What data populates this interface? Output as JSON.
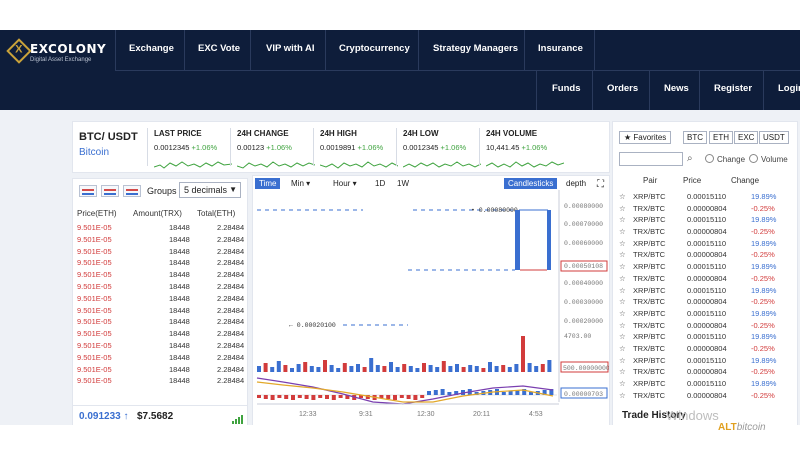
{
  "brand": {
    "name": "EXCOLONY",
    "tagline": "Digital Asset Exchange",
    "mark": "X"
  },
  "nav": {
    "items": [
      "Exchange",
      "EXC Vote",
      "VIP with AI",
      "Cryptocurrency",
      "Strategy Managers",
      "Insurance"
    ],
    "sub_items": [
      "Funds",
      "Orders",
      "News",
      "Register",
      "Login"
    ]
  },
  "ticker": {
    "pair": "BTC/ USDT",
    "coin_name": "Bitcoin",
    "stats": [
      {
        "label": "LAST PRICE",
        "value": "0.0012345",
        "change": "+1.06%"
      },
      {
        "label": "24H CHANGE",
        "value": "0.00123",
        "change": "+1.06%"
      },
      {
        "label": "24H HIGH",
        "value": "0.0019891",
        "change": "+1.06%"
      },
      {
        "label": "24H LOW",
        "value": "0.0012345",
        "change": "+1.06%"
      },
      {
        "label": "24H VOLUME",
        "value": "10,441.45",
        "change": "+1.06%"
      }
    ]
  },
  "orderbook": {
    "groups_label": "Groups",
    "groups_value": "5 decimals",
    "headers": [
      "Price(ETH)",
      "Amount(TRX)",
      "Total(ETH)"
    ],
    "rows": [
      [
        "9.501E-05",
        "18448",
        "2.28484"
      ],
      [
        "9.501E-05",
        "18448",
        "2.28484"
      ],
      [
        "9.501E-05",
        "18448",
        "2.28484"
      ],
      [
        "9.501E-05",
        "18448",
        "2.28484"
      ],
      [
        "9.501E-05",
        "18448",
        "2.28484"
      ],
      [
        "9.501E-05",
        "18448",
        "2.28484"
      ],
      [
        "9.501E-05",
        "18448",
        "2.28484"
      ],
      [
        "9.501E-05",
        "18448",
        "2.28484"
      ],
      [
        "9.501E-05",
        "18448",
        "2.28484"
      ],
      [
        "9.501E-05",
        "18448",
        "2.28484"
      ],
      [
        "9.501E-05",
        "18448",
        "2.28484"
      ],
      [
        "9.501E-05",
        "18448",
        "2.28484"
      ],
      [
        "9.501E-05",
        "18448",
        "2.28484"
      ],
      [
        "9.501E-05",
        "18448",
        "2.28484"
      ]
    ],
    "last_price": "0.091233 ↑",
    "last_usd": "$7.5682"
  },
  "chart_toolbar": {
    "time": "Time",
    "min": "Min",
    "hour": "Hour",
    "d1": "1D",
    "w1": "1W",
    "candlesticks": "Candlesticks",
    "depth": "depth"
  },
  "chart_data": {
    "type": "candlestick",
    "price_ticks": [
      "0.00080000",
      "0.00070000",
      "0.00060000",
      "0.00050108",
      "0.00040000",
      "0.00030000",
      "0.00020000"
    ],
    "volume_tick": "4703.00",
    "volume_max_label": "500.00000000",
    "indicator_label": "0.00000703",
    "annotations": [
      "0.00080000",
      "0.00020100"
    ],
    "time_labels": [
      "12:33",
      "9:31",
      "12:30",
      "20:11",
      "4:53"
    ]
  },
  "favorites": {
    "button": "★ Favorites",
    "quotes": [
      "BTC",
      "ETH",
      "EXC",
      "USDT"
    ],
    "radio_change": "Change",
    "radio_volume": "Volume",
    "headers": [
      "Pair",
      "Price",
      "Change"
    ],
    "rows": [
      [
        "XRP/BTC",
        "0.00015110",
        "19.89%",
        "pos"
      ],
      [
        "TRX/BTC",
        "0.00000804",
        "-0.25%",
        "neg"
      ],
      [
        "XRP/BTC",
        "0.00015110",
        "19.89%",
        "pos"
      ],
      [
        "TRX/BTC",
        "0.00000804",
        "-0.25%",
        "neg"
      ],
      [
        "XRP/BTC",
        "0.00015110",
        "19.89%",
        "pos"
      ],
      [
        "TRX/BTC",
        "0.00000804",
        "-0.25%",
        "neg"
      ],
      [
        "XRP/BTC",
        "0.00015110",
        "19.89%",
        "pos"
      ],
      [
        "TRX/BTC",
        "0.00000804",
        "-0.25%",
        "neg"
      ],
      [
        "XRP/BTC",
        "0.00015110",
        "19.89%",
        "pos"
      ],
      [
        "TRX/BTC",
        "0.00000804",
        "-0.25%",
        "neg"
      ],
      [
        "XRP/BTC",
        "0.00015110",
        "19.89%",
        "pos"
      ],
      [
        "TRX/BTC",
        "0.00000804",
        "-0.25%",
        "neg"
      ],
      [
        "XRP/BTC",
        "0.00015110",
        "19.89%",
        "pos"
      ],
      [
        "TRX/BTC",
        "0.00000804",
        "-0.25%",
        "neg"
      ],
      [
        "XRP/BTC",
        "0.00015110",
        "19.89%",
        "pos"
      ],
      [
        "TRX/BTC",
        "0.00000804",
        "-0.25%",
        "neg"
      ],
      [
        "XRP/BTC",
        "0.00015110",
        "19.89%",
        "pos"
      ],
      [
        "TRX/BTC",
        "0.00000804",
        "-0.25%",
        "neg"
      ]
    ]
  },
  "trade_history": "Trade History",
  "watermark": "Windows",
  "alt_logo": {
    "main": "ALT",
    "sub": "bitcoin"
  },
  "colors": {
    "nav_bg": "#0e1d3a",
    "accent_gold": "#c9a23a",
    "positive": "#3fa33f",
    "negative": "#d23b3b",
    "blue": "#3a6fd0"
  }
}
